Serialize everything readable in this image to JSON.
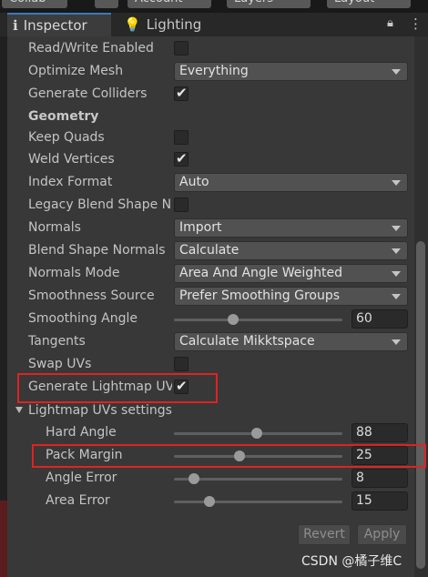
{
  "toolbar": {
    "collab": "Collab",
    "account": "Account",
    "layers": "Layers",
    "layout": "Layout"
  },
  "tabs": {
    "inspector": "Inspector",
    "lighting": "Lighting",
    "lock_icon": "lock-icon",
    "menu_icon": "menu-icon"
  },
  "rows": {
    "read_write": {
      "label": "Read/Write Enabled",
      "checked": false
    },
    "optimize_mesh": {
      "label": "Optimize Mesh",
      "value": "Everything"
    },
    "generate_colliders": {
      "label": "Generate Colliders",
      "checked": true
    },
    "geometry_header": "Geometry",
    "keep_quads": {
      "label": "Keep Quads",
      "checked": false
    },
    "weld_vertices": {
      "label": "Weld Vertices",
      "checked": true
    },
    "index_format": {
      "label": "Index Format",
      "value": "Auto"
    },
    "legacy_blend": {
      "label": "Legacy Blend Shape N",
      "checked": false
    },
    "normals": {
      "label": "Normals",
      "value": "Import"
    },
    "blend_shape_normals": {
      "label": "Blend Shape Normals",
      "value": "Calculate"
    },
    "normals_mode": {
      "label": "Normals Mode",
      "value": "Area And Angle Weighted"
    },
    "smoothness_source": {
      "label": "Smoothness Source",
      "value": "Prefer Smoothing Groups"
    },
    "smoothing_angle": {
      "label": "Smoothing Angle",
      "value": "60",
      "slider_fraction": 0.35
    },
    "tangents": {
      "label": "Tangents",
      "value": "Calculate Mikktspace"
    },
    "swap_uvs": {
      "label": "Swap UVs",
      "checked": false
    },
    "generate_lightmap_uvs": {
      "label": "Generate Lightmap UV",
      "checked": true
    },
    "lightmap_header": "Lightmap UVs settings",
    "hard_angle": {
      "label": "Hard Angle",
      "value": "88",
      "slider_fraction": 0.49
    },
    "pack_margin": {
      "label": "Pack Margin",
      "value": "25",
      "slider_fraction": 0.39
    },
    "angle_error": {
      "label": "Angle Error",
      "value": "8",
      "slider_fraction": 0.12
    },
    "area_error": {
      "label": "Area Error",
      "value": "15",
      "slider_fraction": 0.21
    }
  },
  "buttons": {
    "revert": "Revert",
    "apply": "Apply"
  },
  "watermark": "CSDN @橘子维C",
  "colors": {
    "highlight_box": "#e02222",
    "tab_accent": "#3a79bb"
  }
}
